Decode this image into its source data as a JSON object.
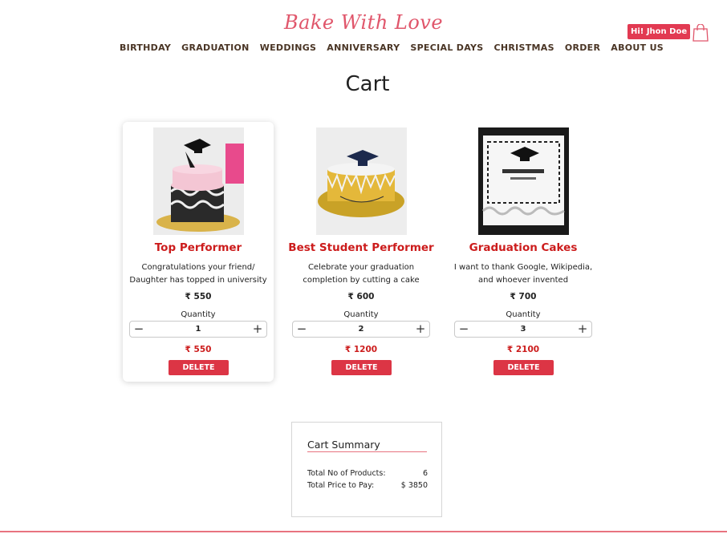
{
  "header": {
    "brand": "Bake With Love",
    "nav": [
      "BIRTHDAY",
      "GRADUATION",
      "WEDDINGS",
      "ANNIVERSARY",
      "SPECIAL DAYS",
      "CHRISTMAS",
      "ORDER",
      "ABOUT US"
    ],
    "user_greeting": "Hi! Jhon Doe",
    "cart_icon": "shopping-bag-icon"
  },
  "page": {
    "title": "Cart"
  },
  "cart": {
    "qty_label": "Quantity",
    "delete_label": "DELETE",
    "minus": "−",
    "plus": "+",
    "items": [
      {
        "name": "Top Performer",
        "desc": "Congratulations your friend/ Daughter has topped in university",
        "price": "₹ 550",
        "qty": "1",
        "subtotal": "₹ 550"
      },
      {
        "name": "Best Student Performer",
        "desc": "Celebrate your graduation completion by cutting a cake",
        "price": "₹ 600",
        "qty": "2",
        "subtotal": "₹ 1200"
      },
      {
        "name": "Graduation Cakes",
        "desc": "I want to thank Google, Wikipedia, and whoever invented",
        "price": "₹ 700",
        "qty": "3",
        "subtotal": "₹ 2100"
      }
    ]
  },
  "summary": {
    "title": "Cart Summary",
    "products_label": "Total No of Products:",
    "products_value": "6",
    "price_label": "Total Price to Pay:",
    "price_value": "$ 3850"
  },
  "colors": {
    "brand": "#e0566b",
    "accent": "#dc3545",
    "price_red": "#cc1c1c",
    "nav_text": "#4a3525"
  }
}
